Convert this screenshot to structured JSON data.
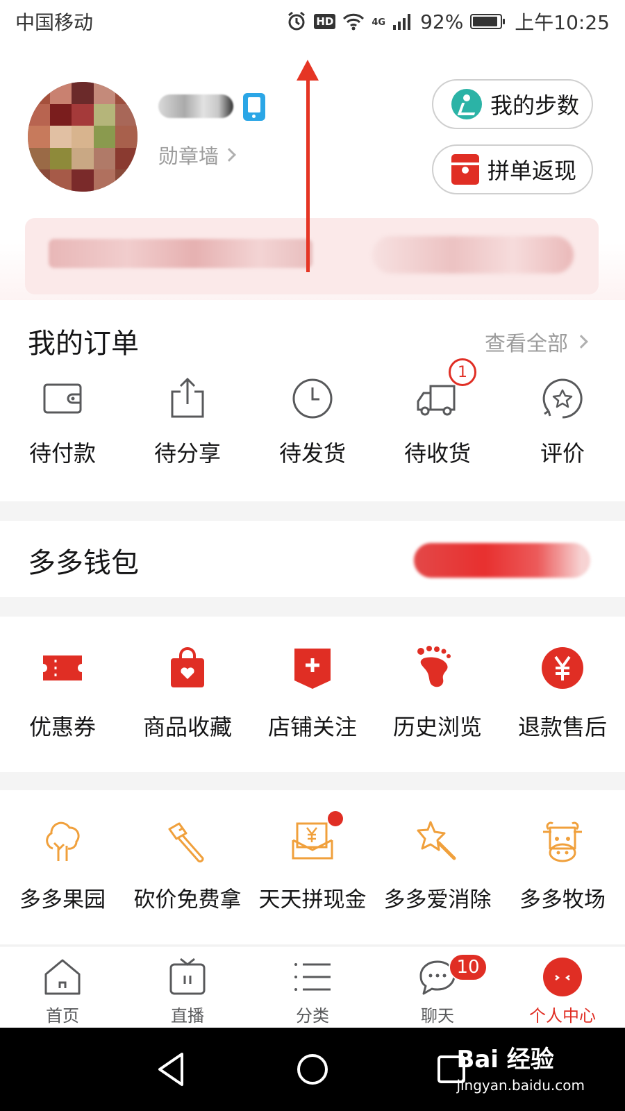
{
  "status_bar": {
    "carrier": "中国移动",
    "hd": "HD",
    "network": "4G",
    "battery": "92%",
    "battery_level": 0.92,
    "time": "上午10:25"
  },
  "profile": {
    "badge_wall": "勋章墙",
    "steps_button": "我的步数",
    "cashback_button": "拼单返现"
  },
  "orders": {
    "title": "我的订单",
    "view_all": "查看全部",
    "items": [
      {
        "label": "待付款",
        "icon": "wallet-icon"
      },
      {
        "label": "待分享",
        "icon": "share-icon"
      },
      {
        "label": "待发货",
        "icon": "clock-icon"
      },
      {
        "label": "待收货",
        "icon": "truck-icon",
        "badge": "1"
      },
      {
        "label": "评价",
        "icon": "review-star-icon"
      }
    ]
  },
  "wallet": {
    "title": "多多钱包"
  },
  "services": {
    "items": [
      {
        "label": "优惠券",
        "icon": "coupon-icon"
      },
      {
        "label": "商品收藏",
        "icon": "favorite-bag-icon"
      },
      {
        "label": "店铺关注",
        "icon": "store-follow-icon"
      },
      {
        "label": "历史浏览",
        "icon": "footprint-icon"
      },
      {
        "label": "退款售后",
        "icon": "refund-yuan-icon"
      }
    ]
  },
  "games": {
    "items": [
      {
        "label": "多多果园",
        "icon": "tree-icon"
      },
      {
        "label": "砍价免费拿",
        "icon": "axe-icon"
      },
      {
        "label": "天天拼现金",
        "icon": "cash-envelope-icon"
      },
      {
        "label": "多多爱消除",
        "icon": "star-wand-icon"
      },
      {
        "label": "多多牧场",
        "icon": "cow-icon"
      }
    ]
  },
  "tabbar": {
    "items": [
      {
        "label": "首页",
        "icon": "home-icon"
      },
      {
        "label": "直播",
        "icon": "tv-icon"
      },
      {
        "label": "分类",
        "icon": "list-icon"
      },
      {
        "label": "聊天",
        "icon": "chat-icon",
        "badge": "10"
      },
      {
        "label": "个人中心",
        "icon": "profile-face-icon",
        "active": true
      }
    ]
  },
  "watermark": {
    "brand": "Bai 经验",
    "url": "jingyan.baidu.com"
  },
  "colors": {
    "brand_red": "#e02e24",
    "orange_accent": "#f0a03c",
    "step_teal": "#2bb3a6"
  }
}
